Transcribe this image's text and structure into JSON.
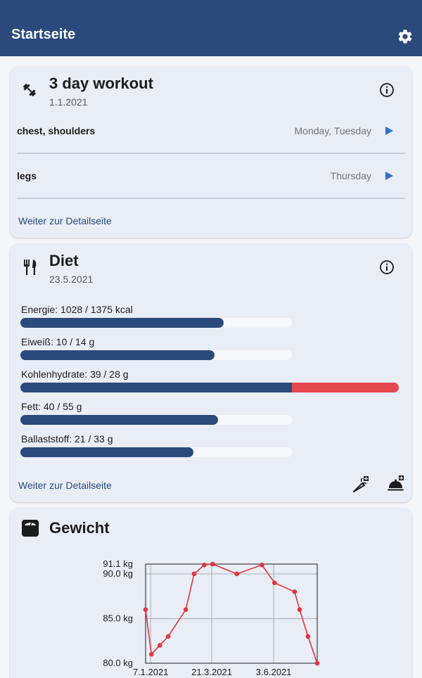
{
  "app": {
    "title": "Startseite",
    "settings_icon": "gear-icon",
    "brand_color": "#2a4a7c",
    "accent_color": "#2f6fd0",
    "over_color": "#e5484d"
  },
  "workout": {
    "icon": "dumbbell-icon",
    "title": "3 day workout",
    "date": "1.1.2021",
    "rows": [
      {
        "name": "chest, shoulders",
        "days": "Monday, Tuesday"
      },
      {
        "name": "legs",
        "days": "Thursday"
      }
    ],
    "link": "Weiter zur Detailseite"
  },
  "diet": {
    "icon": "fork-knife-icon",
    "title": "Diet",
    "date": "23.5.2021",
    "nutrients": [
      {
        "label": "Energie: 1028 / 1375 kcal",
        "value": 1028,
        "target": 1375
      },
      {
        "label": "Eiweiß: 10 / 14 g",
        "value": 10,
        "target": 14
      },
      {
        "label": "Kohlenhydrate: 39 / 28 g",
        "value": 39,
        "target": 28
      },
      {
        "label": "Fett: 40 / 55 g",
        "value": 40,
        "target": 55
      },
      {
        "label": "Ballaststoff: 21 / 33 g",
        "value": 21,
        "target": 33
      }
    ],
    "link": "Weiter zur Detailseite",
    "action_icons": [
      "carrot-add-icon",
      "cloche-add-icon"
    ]
  },
  "weight": {
    "icon": "scale-icon",
    "title": "Gewicht",
    "chart_data": {
      "type": "line",
      "series": [
        {
          "x": [
            "2021-01-01",
            "2021-01-08",
            "2021-01-18",
            "2021-01-28",
            "2021-02-18",
            "2021-02-28",
            "2021-03-12",
            "2021-03-22",
            "2021-04-20",
            "2021-05-20",
            "2021-06-04",
            "2021-06-28",
            "2021-07-04",
            "2021-07-14",
            "2021-07-25"
          ],
          "values": [
            86.0,
            81.0,
            82.0,
            83.0,
            86.0,
            90.0,
            91.0,
            91.1,
            90.0,
            91.0,
            89.0,
            88.0,
            86.0,
            83.0,
            80.0
          ]
        }
      ],
      "x_ticks": [
        "7.1.2021",
        "21.3.2021",
        "3.6.2021"
      ],
      "y_ticks": [
        "91.1 kg",
        "90.0 kg",
        "85.0 kg",
        "80.0 kg"
      ],
      "ylim": [
        80.0,
        91.1
      ],
      "xlim": [
        "2021-01-01",
        "2021-07-25"
      ],
      "grid": true,
      "line_color": "#e0353f"
    }
  }
}
